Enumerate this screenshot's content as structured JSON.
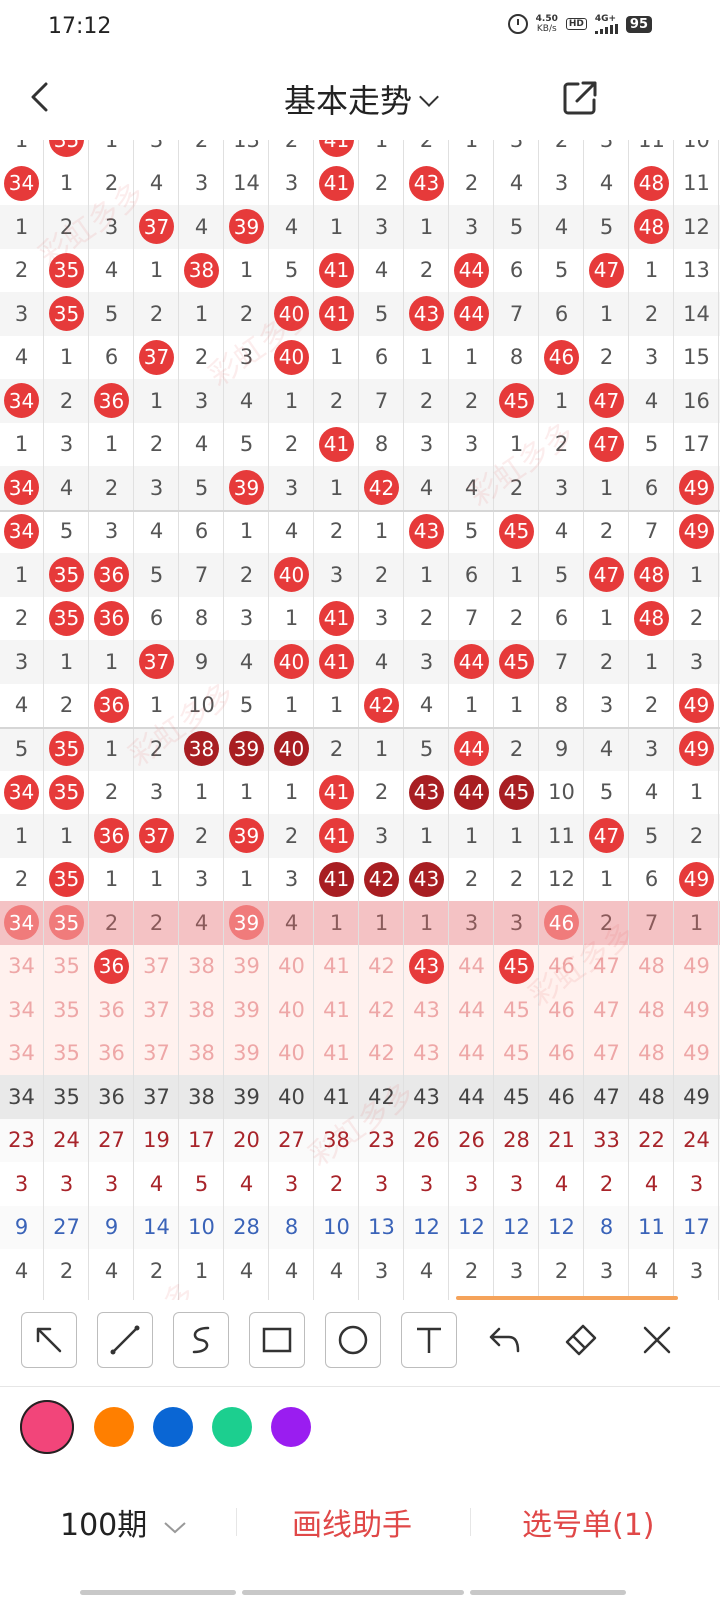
{
  "status_bar": {
    "time": "17:12",
    "speed": "4.50",
    "speed_unit": "KB/s",
    "hd": "HD",
    "network": "4G+",
    "battery": "95"
  },
  "header": {
    "title": "基本走势"
  },
  "watermark": "彩虹多多",
  "grid": {
    "top_partial": [
      "1",
      "35",
      "1",
      "3",
      "2",
      "13",
      "2",
      "41",
      "1",
      "2",
      "1",
      "3",
      "2",
      "3",
      "11",
      "10"
    ],
    "rows": [
      [
        "34",
        "1",
        "2",
        "4",
        "3",
        "14",
        "3",
        "41",
        "2",
        "43",
        "2",
        "4",
        "3",
        "4",
        "48",
        "11"
      ],
      [
        "1",
        "2",
        "3",
        "37",
        "4",
        "39",
        "4",
        "1",
        "3",
        "1",
        "3",
        "5",
        "4",
        "5",
        "48",
        "12"
      ],
      [
        "2",
        "35",
        "4",
        "1",
        "38",
        "1",
        "5",
        "41",
        "4",
        "2",
        "44",
        "6",
        "5",
        "47",
        "1",
        "13"
      ],
      [
        "3",
        "35",
        "5",
        "2",
        "1",
        "2",
        "40",
        "41",
        "5",
        "43",
        "44",
        "7",
        "6",
        "1",
        "2",
        "14"
      ],
      [
        "4",
        "1",
        "6",
        "37",
        "2",
        "3",
        "40",
        "1",
        "6",
        "1",
        "1",
        "8",
        "46",
        "2",
        "3",
        "15"
      ],
      [
        "34",
        "2",
        "36",
        "1",
        "3",
        "4",
        "1",
        "2",
        "7",
        "2",
        "2",
        "45",
        "1",
        "47",
        "4",
        "16"
      ],
      [
        "1",
        "3",
        "1",
        "2",
        "4",
        "5",
        "2",
        "41",
        "8",
        "3",
        "3",
        "1",
        "2",
        "47",
        "5",
        "17"
      ],
      [
        "34",
        "4",
        "2",
        "3",
        "5",
        "39",
        "3",
        "1",
        "42",
        "4",
        "4",
        "2",
        "3",
        "1",
        "6",
        "49"
      ],
      [
        "34",
        "5",
        "3",
        "4",
        "6",
        "1",
        "4",
        "2",
        "1",
        "43",
        "5",
        "45",
        "4",
        "2",
        "7",
        "49"
      ],
      [
        "1",
        "35",
        "36",
        "5",
        "7",
        "2",
        "40",
        "3",
        "2",
        "1",
        "6",
        "1",
        "5",
        "47",
        "48",
        "1"
      ],
      [
        "2",
        "35",
        "36",
        "6",
        "8",
        "3",
        "1",
        "41",
        "3",
        "2",
        "7",
        "2",
        "6",
        "1",
        "48",
        "2"
      ],
      [
        "3",
        "1",
        "1",
        "37",
        "9",
        "4",
        "40",
        "41",
        "4",
        "3",
        "44",
        "45",
        "7",
        "2",
        "1",
        "3"
      ],
      [
        "4",
        "2",
        "36",
        "1",
        "10",
        "5",
        "1",
        "1",
        "42",
        "4",
        "1",
        "1",
        "8",
        "3",
        "2",
        "49"
      ],
      [
        "5",
        "35",
        "1",
        "2",
        "38",
        "39",
        "40",
        "2",
        "1",
        "5",
        "44",
        "2",
        "9",
        "4",
        "3",
        "49"
      ],
      [
        "34",
        "35",
        "2",
        "3",
        "1",
        "1",
        "1",
        "41",
        "2",
        "43",
        "44",
        "45",
        "10",
        "5",
        "4",
        "1"
      ],
      [
        "1",
        "1",
        "36",
        "37",
        "2",
        "39",
        "2",
        "41",
        "3",
        "1",
        "1",
        "1",
        "11",
        "47",
        "5",
        "2"
      ],
      [
        "2",
        "35",
        "1",
        "1",
        "3",
        "1",
        "3",
        "41",
        "42",
        "43",
        "2",
        "2",
        "12",
        "1",
        "6",
        "49"
      ]
    ],
    "highlight_row": [
      "34",
      "35",
      "2",
      "2",
      "4",
      "39",
      "4",
      "1",
      "1",
      "1",
      "3",
      "3",
      "46",
      "2",
      "7",
      "1"
    ],
    "pick_rows": [
      [
        "34",
        "35",
        "36",
        "37",
        "38",
        "39",
        "40",
        "41",
        "42",
        "43",
        "44",
        "45",
        "46",
        "47",
        "48",
        "49"
      ],
      [
        "34",
        "35",
        "36",
        "37",
        "38",
        "39",
        "40",
        "41",
        "42",
        "43",
        "44",
        "45",
        "46",
        "47",
        "48",
        "49"
      ],
      [
        "34",
        "35",
        "36",
        "37",
        "38",
        "39",
        "40",
        "41",
        "42",
        "43",
        "44",
        "45",
        "46",
        "47",
        "48",
        "49"
      ]
    ],
    "number_header": [
      "34",
      "35",
      "36",
      "37",
      "38",
      "39",
      "40",
      "41",
      "42",
      "43",
      "44",
      "45",
      "46",
      "47",
      "48",
      "49"
    ],
    "stats": [
      [
        "23",
        "24",
        "27",
        "19",
        "17",
        "20",
        "27",
        "38",
        "23",
        "26",
        "26",
        "28",
        "21",
        "33",
        "22",
        "24"
      ],
      [
        "3",
        "3",
        "3",
        "4",
        "5",
        "4",
        "3",
        "2",
        "3",
        "3",
        "3",
        "3",
        "4",
        "2",
        "4",
        "3"
      ],
      [
        "9",
        "27",
        "9",
        "14",
        "10",
        "28",
        "8",
        "10",
        "13",
        "12",
        "12",
        "12",
        "12",
        "8",
        "11",
        "17"
      ],
      [
        "4",
        "2",
        "4",
        "2",
        "1",
        "4",
        "4",
        "4",
        "3",
        "4",
        "2",
        "3",
        "2",
        "3",
        "4",
        "3"
      ]
    ],
    "stat_colors": [
      "#a8242a",
      "#a8242a",
      "#3a63b8",
      "#555555"
    ]
  },
  "toolbar": {
    "tools": [
      "arrow-icon",
      "line-icon",
      "curve-icon",
      "rectangle-icon",
      "circle-icon",
      "text-icon",
      "undo-icon",
      "eraser-icon",
      "close-icon"
    ]
  },
  "colors": [
    "#f2457a",
    "#ff7f00",
    "#0a66d4",
    "#1ccf8f",
    "#9a1df0"
  ],
  "bottom": {
    "periods": "100期",
    "draw_helper": "画线助手",
    "pick_list": "选号单(1)"
  }
}
